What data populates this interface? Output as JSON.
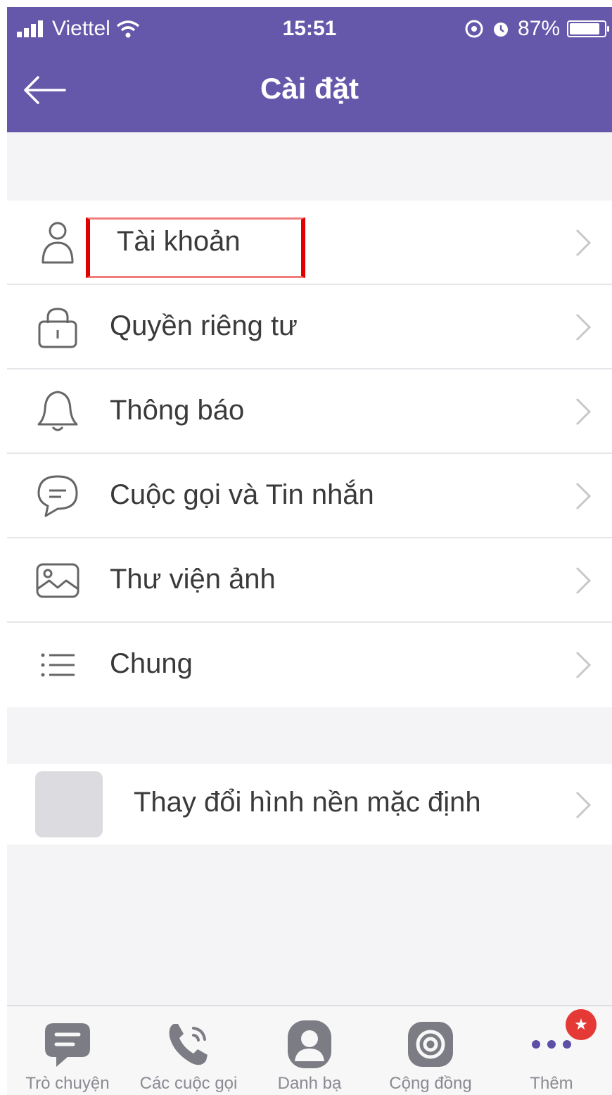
{
  "status_bar": {
    "carrier": "Viettel",
    "time": "15:51",
    "battery": "87%"
  },
  "header": {
    "title": "Cài đặt"
  },
  "settings": {
    "items": [
      {
        "label": "Tài khoản",
        "icon": "user-icon"
      },
      {
        "label": "Quyền riêng tư",
        "icon": "lock-icon"
      },
      {
        "label": "Thông báo",
        "icon": "bell-icon"
      },
      {
        "label": "Cuộc gọi và Tin nhắn",
        "icon": "chat-bubble-icon"
      },
      {
        "label": "Thư viện ảnh",
        "icon": "image-icon"
      },
      {
        "label": "Chung",
        "icon": "list-icon"
      }
    ]
  },
  "wallpaper": {
    "label": "Thay đổi hình nền mặc định"
  },
  "tabbar": {
    "tabs": [
      {
        "label": "Trò chuyện",
        "icon": "chat-icon"
      },
      {
        "label": "Các cuộc gọi",
        "icon": "phone-icon"
      },
      {
        "label": "Danh bạ",
        "icon": "contact-icon"
      },
      {
        "label": "Cộng đồng",
        "icon": "community-icon"
      },
      {
        "label": "Thêm",
        "icon": "more-icon"
      }
    ],
    "badge": "★"
  },
  "colors": {
    "header": "#6558ab",
    "highlight": "#e00000",
    "badge": "#e53935"
  }
}
